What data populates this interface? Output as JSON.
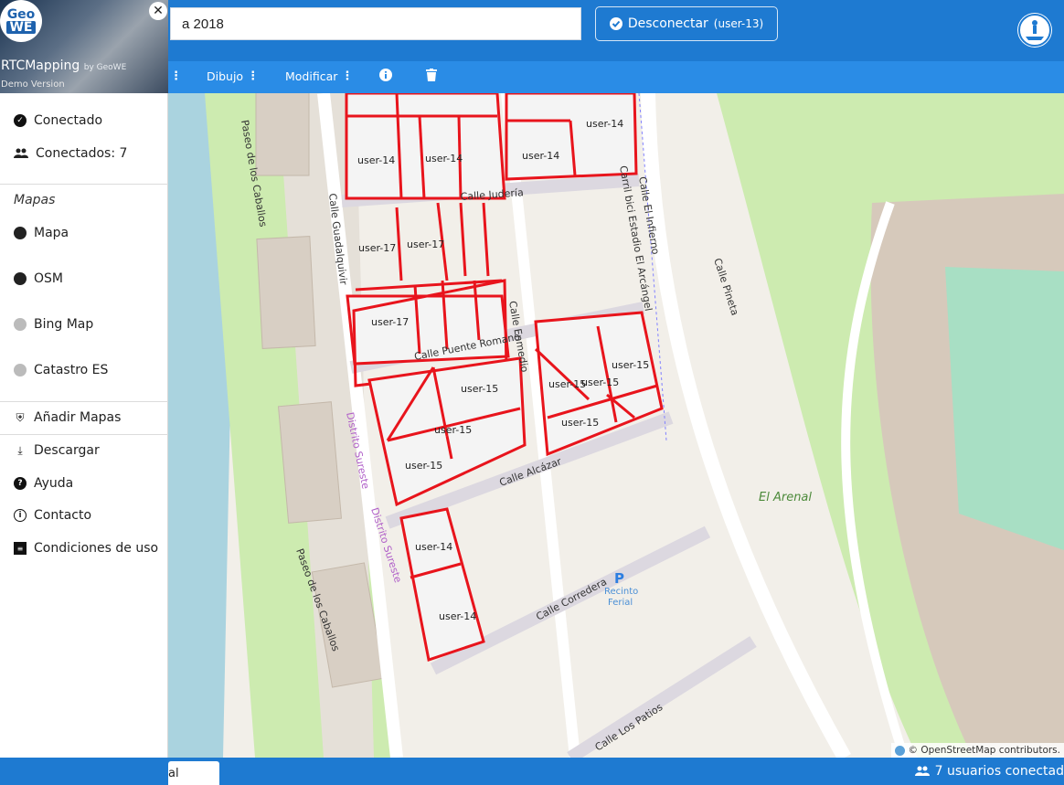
{
  "header": {
    "search_value": "a 2018",
    "connect_button": {
      "label": "Desconectar",
      "user": "(user-13)"
    }
  },
  "toolbar": {
    "items": [
      {
        "label": "",
        "icon": "kebab-icon"
      },
      {
        "label": "Dibujo",
        "icon": "kebab-icon"
      },
      {
        "label": "Modificar",
        "icon": "kebab-icon"
      }
    ],
    "info_icon": "info-icon",
    "delete_icon": "trash-icon"
  },
  "sidebar": {
    "logo": {
      "line1": "Geo",
      "line2": "WE"
    },
    "app_name": "RTCMapping",
    "app_by": "by GeoWE",
    "demo_label": "Demo Version",
    "status": {
      "connected": "Conectado",
      "users": "Conectados: 7"
    },
    "maps_title": "Mapas",
    "maps": [
      {
        "label": "Mapa",
        "enabled": true
      },
      {
        "label": "OSM",
        "enabled": true
      },
      {
        "label": "Bing Map",
        "enabled": false
      },
      {
        "label": "Catastro ES",
        "enabled": false
      }
    ],
    "add_maps": "Añadir Mapas",
    "menu": [
      {
        "label": "Descargar",
        "icon": "download-icon"
      },
      {
        "label": "Ayuda",
        "icon": "help-icon"
      },
      {
        "label": "Contacto",
        "icon": "info-icon"
      },
      {
        "label": "Condiciones de uso",
        "icon": "document-icon"
      }
    ]
  },
  "map": {
    "streets": [
      "Calle Judería",
      "Calle Guadalquivir",
      "Calle El Infierno",
      "Carril bici Estadio El Arcángel",
      "Calle Puente Romano",
      "Calle Enmedio",
      "Calle Pineta",
      "Calle Alcázar",
      "Calle Corredera",
      "Calle Los Patios",
      "Paseo de los Caballos",
      "Distrito Sureste",
      "El Arenal",
      "Recinto",
      "Ferial"
    ],
    "parcels": [
      "user-14",
      "user-14",
      "user-14",
      "user-14",
      "user-17",
      "user-17",
      "user-17",
      "user-15",
      "user-15",
      "user-15",
      "user-15",
      "user-15",
      "user-15",
      "user-15",
      "user-14",
      "user-14"
    ],
    "parking": "P",
    "attribution": "© OpenStreetMap contributors."
  },
  "footer": {
    "tab_label": "al",
    "users_online": "7 usuarios conectad"
  },
  "colors": {
    "header": "#1e7ad1",
    "toolbar": "#2a8ce6",
    "parcel": "#e8141c"
  }
}
